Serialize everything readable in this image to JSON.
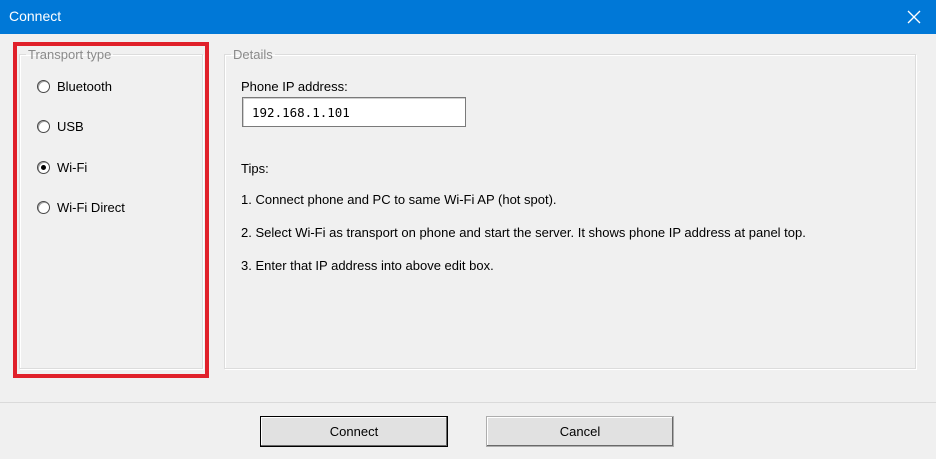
{
  "window": {
    "title": "Connect",
    "accent": "#0078d7",
    "close_icon": "close-icon"
  },
  "transport": {
    "legend": "Transport type",
    "options": [
      {
        "label": "Bluetooth",
        "checked": false
      },
      {
        "label": "USB",
        "checked": false
      },
      {
        "label": "Wi-Fi",
        "checked": true
      },
      {
        "label": "Wi-Fi Direct",
        "checked": false
      }
    ]
  },
  "details": {
    "legend": "Details",
    "ip_label": "Phone IP address:",
    "ip_value": "192.168.1.101",
    "tips_title": "Tips:",
    "tips": [
      "1. Connect phone and PC to same Wi-Fi AP (hot spot).",
      "2. Select Wi-Fi as transport on phone and start the server. It shows phone IP address at panel top.",
      "3. Enter that IP address into above edit box."
    ]
  },
  "buttons": {
    "connect": "Connect",
    "cancel": "Cancel"
  },
  "highlight_color": "#e0202a"
}
